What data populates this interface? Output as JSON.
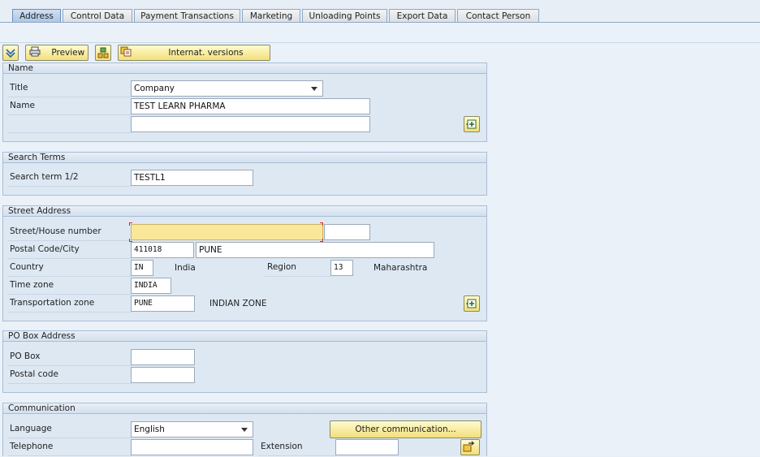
{
  "tabs": [
    {
      "label": "Address",
      "active": true
    },
    {
      "label": "Control Data"
    },
    {
      "label": "Payment Transactions"
    },
    {
      "label": "Marketing"
    },
    {
      "label": "Unloading Points"
    },
    {
      "label": "Export Data"
    },
    {
      "label": "Contact Person"
    }
  ],
  "toolbar": {
    "preview_label": "Preview",
    "intl_versions_label": "Internat. versions"
  },
  "name_group": {
    "title": "Name",
    "title_label": "Title",
    "title_value": "Company",
    "name_label": "Name",
    "name_value": "TEST LEARN PHARMA",
    "name2_value": ""
  },
  "search_group": {
    "title": "Search Terms",
    "label": "Search term 1/2",
    "value": "TESTL1"
  },
  "street_group": {
    "title": "Street Address",
    "street_label": "Street/House number",
    "street_value": "",
    "house_value": "",
    "postal_label": "Postal Code/City",
    "postal_value": "411018",
    "city_value": "PUNE",
    "country_label": "Country",
    "country_code": "IN",
    "country_name": "India",
    "region_label": "Region",
    "region_code": "13",
    "region_name": "Maharashtra",
    "timezone_label": "Time zone",
    "timezone_value": "INDIA",
    "transport_label": "Transportation zone",
    "transport_value": "PUNE",
    "transport_name": "INDIAN ZONE"
  },
  "pobox_group": {
    "title": "PO Box Address",
    "pobox_label": "PO Box",
    "pobox_value": "",
    "postal_label": "Postal code",
    "postal_value": ""
  },
  "comm_group": {
    "title": "Communication",
    "language_label": "Language",
    "language_value": "English",
    "other_comm_label": "Other communication...",
    "telephone_label": "Telephone",
    "telephone_value": "",
    "extension_label": "Extension",
    "extension_value": ""
  },
  "colors": {
    "accent": "#f2df7a",
    "group_bg": "#dde8f3",
    "required": "#fbe79a"
  }
}
